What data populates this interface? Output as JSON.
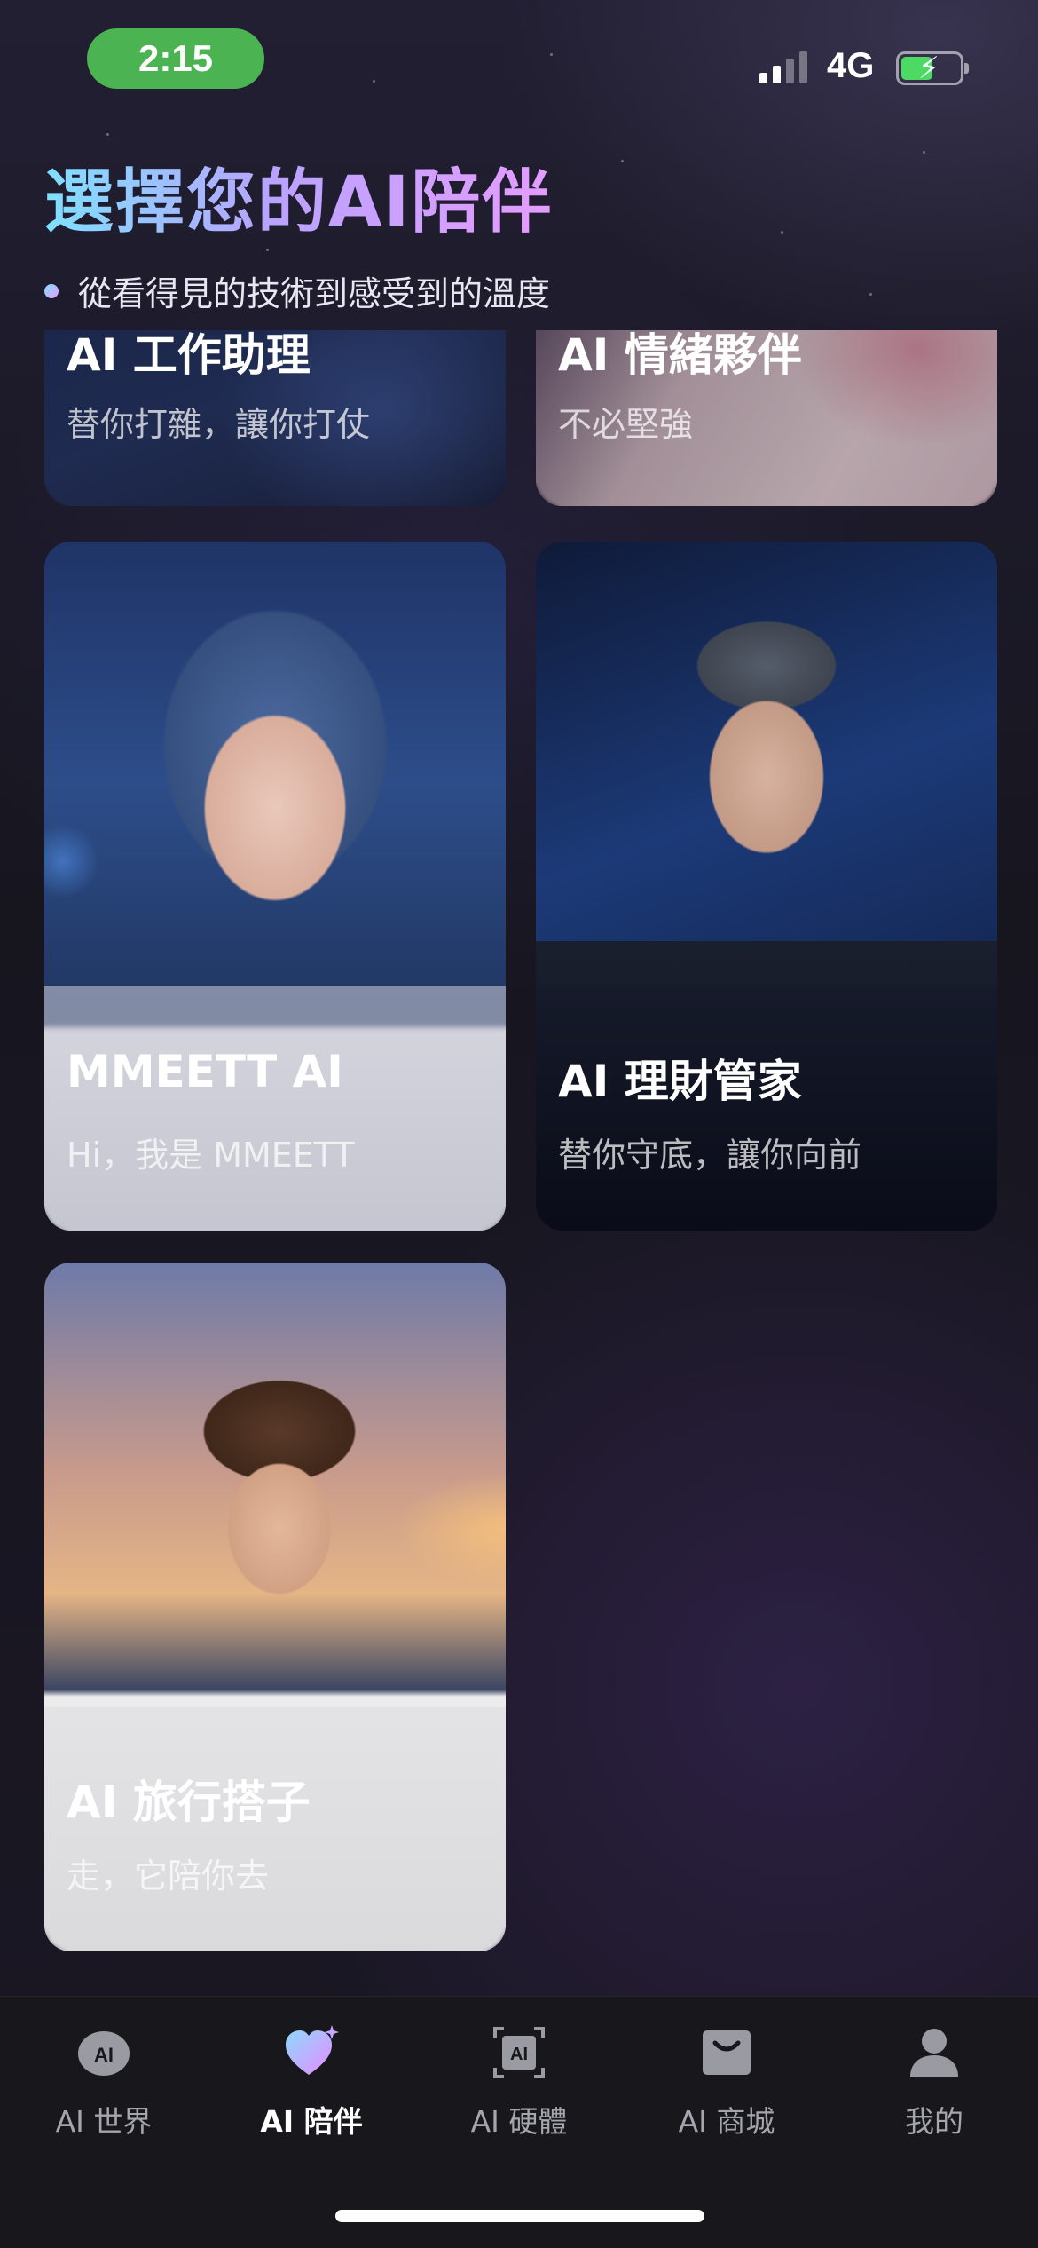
{
  "status_bar": {
    "time": "2:15",
    "network": "4G",
    "battery_charging": true
  },
  "header": {
    "title": "選擇您的AI陪伴",
    "subtitle": "從看得見的技術到感受到的溫度"
  },
  "cards": [
    {
      "name": "AI 工作助理",
      "desc": "替你打雜，讓你打仗"
    },
    {
      "name": "AI 情緒夥伴",
      "desc": "不必堅強"
    },
    {
      "name": "MMEETT AI",
      "desc": "Hi，我是 MMEETT"
    },
    {
      "name": "AI 理財管家",
      "desc": "替你守底，讓你向前"
    },
    {
      "name": "AI 旅行搭子",
      "desc": "走，它陪你去"
    }
  ],
  "nav": {
    "items": [
      {
        "label": "AI 世界",
        "icon": "ai-world-icon",
        "active": false
      },
      {
        "label": "AI 陪伴",
        "icon": "ai-companion-heart-icon",
        "active": true
      },
      {
        "label": "AI 硬體",
        "icon": "ai-hardware-icon",
        "active": false
      },
      {
        "label": "AI 商城",
        "icon": "shopping-bag-icon",
        "active": false
      },
      {
        "label": "我的",
        "icon": "profile-icon",
        "active": false
      }
    ]
  },
  "colors": {
    "accent_gradient_start": "#7fe0ff",
    "accent_gradient_end": "#e59cff",
    "status_green": "#4cb352"
  }
}
